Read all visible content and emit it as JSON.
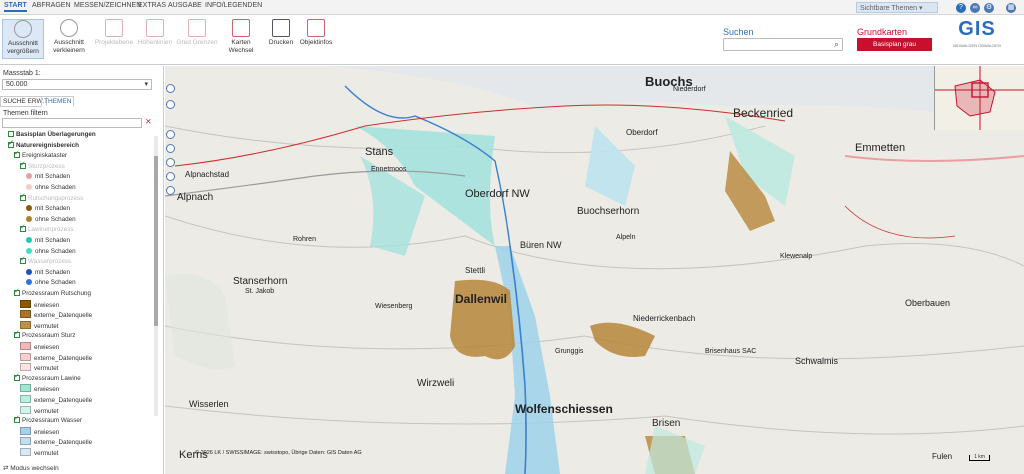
{
  "tabs": [
    "START",
    "ABFRAGEN",
    "MESSEN/ZEICHNEN",
    "EXTRAS",
    "AUSGABE",
    "INFO/LEGENDEN"
  ],
  "topbar": {
    "themes_dropdown": "Sichtbare Themen"
  },
  "ribbon": {
    "zoom_in": [
      "Ausschnitt",
      "vergrößern"
    ],
    "zoom_out": [
      "Ausschnitt",
      "verkleinern"
    ],
    "disabled": [
      "Projektebene",
      "Höhenlinien",
      "Gred Grenzen"
    ],
    "cards": [
      "Karten",
      "Wechsel"
    ],
    "print": "Drucken",
    "objinfo": "Objektinfos"
  },
  "search": {
    "label": "Suchen"
  },
  "grundkarten": {
    "label": "Grundkarten",
    "button": "Basisplan grau"
  },
  "logo": {
    "text": "GIS",
    "sub": "NIDWALDEN OBWALDEN"
  },
  "sidebar": {
    "scale_label": "Massstab 1:",
    "scale_value": "50.000",
    "tabs": [
      "SUCHE ERW.",
      "THEMEN"
    ],
    "filter_label": "Themen filtern",
    "mode_switch": "Modus wechseln"
  },
  "tree": [
    {
      "label": "Basisplan Überlagerungen",
      "bold": true,
      "indent": 1,
      "cb": "off",
      "sw": ""
    },
    {
      "label": "Naturereignisbereich",
      "bold": true,
      "indent": 1,
      "cb": "on",
      "sw": ""
    },
    {
      "label": "Ereigniskataster",
      "indent": 2,
      "cb": "on",
      "sw": ""
    },
    {
      "label": "Sturzprozess",
      "indent": 3,
      "cb": "on",
      "grey": true,
      "sw": ""
    },
    {
      "label": "mit Schaden",
      "indent": 4,
      "sw": "dot",
      "color": "#e8a0a0"
    },
    {
      "label": "ohne Schaden",
      "indent": 4,
      "sw": "dot",
      "color": "#f4cccc"
    },
    {
      "label": "Rutschungsprozess",
      "indent": 3,
      "cb": "on",
      "grey": true,
      "sw": ""
    },
    {
      "label": "mit Schaden",
      "indent": 4,
      "sw": "dot",
      "color": "#8b5a00"
    },
    {
      "label": "ohne Schaden",
      "indent": 4,
      "sw": "dot",
      "color": "#b08028"
    },
    {
      "label": "Lawinenprozess",
      "indent": 3,
      "cb": "on",
      "grey": true,
      "sw": ""
    },
    {
      "label": "mit Schaden",
      "indent": 4,
      "sw": "dot",
      "color": "#20c8b0"
    },
    {
      "label": "ohne Schaden",
      "indent": 4,
      "sw": "dot",
      "color": "#40e0c8"
    },
    {
      "label": "Wasserprozess",
      "indent": 3,
      "cb": "on",
      "grey": true,
      "sw": ""
    },
    {
      "label": "mit Schaden",
      "indent": 4,
      "sw": "dot",
      "color": "#1a50c8"
    },
    {
      "label": "ohne Schaden",
      "indent": 4,
      "sw": "dot",
      "color": "#3070e0"
    },
    {
      "label": "Prozessraum Rutschung",
      "indent": 2,
      "cb": "on",
      "sw": ""
    },
    {
      "label": "erwiesen",
      "indent": 3,
      "sw": "sq",
      "color": "#8b5a00"
    },
    {
      "label": "externe_Datenquelle",
      "indent": 3,
      "sw": "sq",
      "color": "#a87428"
    },
    {
      "label": "vermutet",
      "indent": 3,
      "sw": "sq",
      "color": "#c09048"
    },
    {
      "label": "Prozessraum Sturz",
      "indent": 2,
      "cb": "on",
      "sw": ""
    },
    {
      "label": "erwiesen",
      "indent": 3,
      "sw": "sq",
      "color": "#f2b8b8"
    },
    {
      "label": "externe_Datenquelle",
      "indent": 3,
      "sw": "sq",
      "color": "#f6cece"
    },
    {
      "label": "vermutet",
      "indent": 3,
      "sw": "sq",
      "color": "#fae2e2"
    },
    {
      "label": "Prozessraum Lawine",
      "indent": 2,
      "cb": "on",
      "sw": ""
    },
    {
      "label": "erwiesen",
      "indent": 3,
      "sw": "sq",
      "color": "#9ee8d2"
    },
    {
      "label": "externe_Datenquelle",
      "indent": 3,
      "sw": "sq",
      "color": "#b8efdf"
    },
    {
      "label": "vermutet",
      "indent": 3,
      "sw": "sq",
      "color": "#d0f5ea"
    },
    {
      "label": "Prozessraum Wasser",
      "indent": 2,
      "cb": "on",
      "sw": ""
    },
    {
      "label": "erwiesen",
      "indent": 3,
      "sw": "sq",
      "color": "#a8d0ec"
    },
    {
      "label": "externe_Datenquelle",
      "indent": 3,
      "sw": "sq",
      "color": "#c2def2"
    },
    {
      "label": "vermutet",
      "indent": 3,
      "sw": "sq",
      "color": "#d8eaf7"
    }
  ],
  "map": {
    "labels": [
      {
        "t": "Buochs",
        "s": 13,
        "b": true
      },
      {
        "t": "Beckenried",
        "s": 12
      },
      {
        "t": "Emmetten",
        "s": 11
      },
      {
        "t": "Stans",
        "s": 11
      },
      {
        "t": "Oberdorf NW",
        "s": 11
      },
      {
        "t": "Buochserhorn",
        "s": 10
      },
      {
        "t": "Büren NW",
        "s": 9
      },
      {
        "t": "Dallenwil",
        "s": 12,
        "b": true
      },
      {
        "t": "Alpnach",
        "s": 10
      },
      {
        "t": "Alpnachstad",
        "s": 8
      },
      {
        "t": "Stanserhorn",
        "s": 10
      },
      {
        "t": "Wirzweli",
        "s": 10
      },
      {
        "t": "Wolfenschiessen",
        "s": 12,
        "b": true
      },
      {
        "t": "Kerns",
        "s": 11
      },
      {
        "t": "Wisserlen",
        "s": 9
      },
      {
        "t": "Schwalmis",
        "s": 9
      },
      {
        "t": "Oberbauen",
        "s": 9
      },
      {
        "t": "Brisen",
        "s": 10
      },
      {
        "t": "Niederrickenbach",
        "s": 8
      },
      {
        "t": "Stettli",
        "s": 8
      },
      {
        "t": "St. Jakob",
        "s": 7
      },
      {
        "t": "Oberdorf",
        "s": 8
      },
      {
        "t": "Niederdorf",
        "s": 7
      },
      {
        "t": "Ennetmoos",
        "s": 7
      },
      {
        "t": "Rohren",
        "s": 7
      },
      {
        "t": "Grunggis",
        "s": 7
      },
      {
        "t": "Brisenhaus SAC",
        "s": 7
      },
      {
        "t": "Alpeln",
        "s": 7
      },
      {
        "t": "Klewenalp",
        "s": 7
      },
      {
        "t": "Wiesenberg",
        "s": 7
      },
      {
        "t": "Fulen",
        "s": 8
      }
    ],
    "copyright": "© 2026 LK / SWISSIMAGE: swisstopo, Übrige Daten: GIS Daten AG",
    "scale": "1 km"
  }
}
